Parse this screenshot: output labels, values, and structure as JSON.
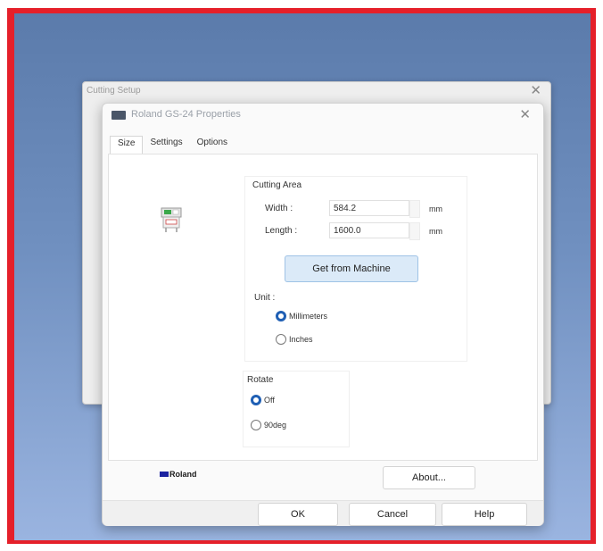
{
  "background_dialog": {
    "title": "Cutting Setup",
    "close": "✕"
  },
  "dialog": {
    "title": "Roland GS-24 Properties",
    "close": "✕",
    "tabs": [
      {
        "label": "Size"
      },
      {
        "label": "Settings"
      },
      {
        "label": "Options"
      }
    ],
    "cutting_area": {
      "title": "Cutting Area",
      "width_label": "Width :",
      "width_value": "584.2",
      "length_label": "Length :",
      "length_value": "1600.0",
      "unit_text": "mm",
      "get_button": "Get from Machine",
      "unit_label": "Unit :",
      "units": [
        {
          "label": "Millimeters",
          "selected": true
        },
        {
          "label": "Inches",
          "selected": false
        }
      ]
    },
    "rotate": {
      "title": "Rotate",
      "options": [
        {
          "label": "Off",
          "selected": true
        },
        {
          "label": "90deg",
          "selected": false
        }
      ]
    },
    "brand": "Roland",
    "about_button": "About...",
    "ok_button": "OK",
    "cancel_button": "Cancel",
    "help_button": "Help"
  },
  "colors": {
    "frame": "#e5202a",
    "accent": "#1f5fb4",
    "machine_button_bg": "#dbeaf8",
    "logo_blue": "#1b22a0"
  }
}
